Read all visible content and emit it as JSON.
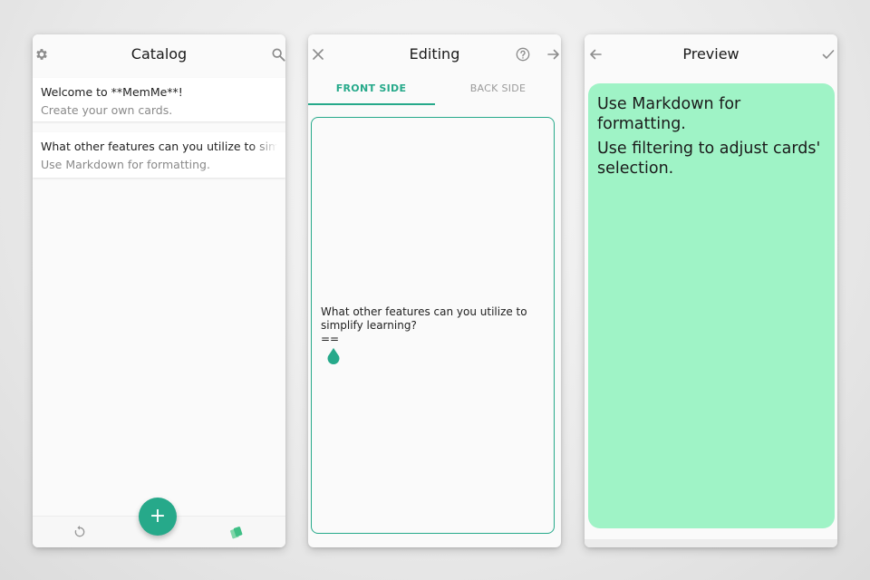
{
  "colors": {
    "accent": "#26a98a",
    "preview_card": "#9ff3c6",
    "background": "#e9e9e9"
  },
  "catalog": {
    "title": "Catalog",
    "icons": {
      "left": "gear-icon",
      "right": "search-icon"
    },
    "cards": [
      {
        "front": "Welcome to **MemMe**!",
        "back": "Create your own cards."
      },
      {
        "front": "What other features can you utilize to simplify learning?",
        "back": "Use Markdown for formatting."
      }
    ],
    "fab_label": "+",
    "bottom_icons": [
      "sync-icon",
      "cards-icon"
    ]
  },
  "editing": {
    "title": "Editing",
    "tabs": [
      {
        "label": "FRONT SIDE",
        "active": true
      },
      {
        "label": "BACK SIDE",
        "active": false
      }
    ],
    "editor_line1": "What other features can you utilize to simplify learning?",
    "editor_line2": "=="
  },
  "preview": {
    "title": "Preview",
    "lines": [
      "Use Markdown for formatting.",
      "Use filtering to adjust cards' selection."
    ]
  }
}
